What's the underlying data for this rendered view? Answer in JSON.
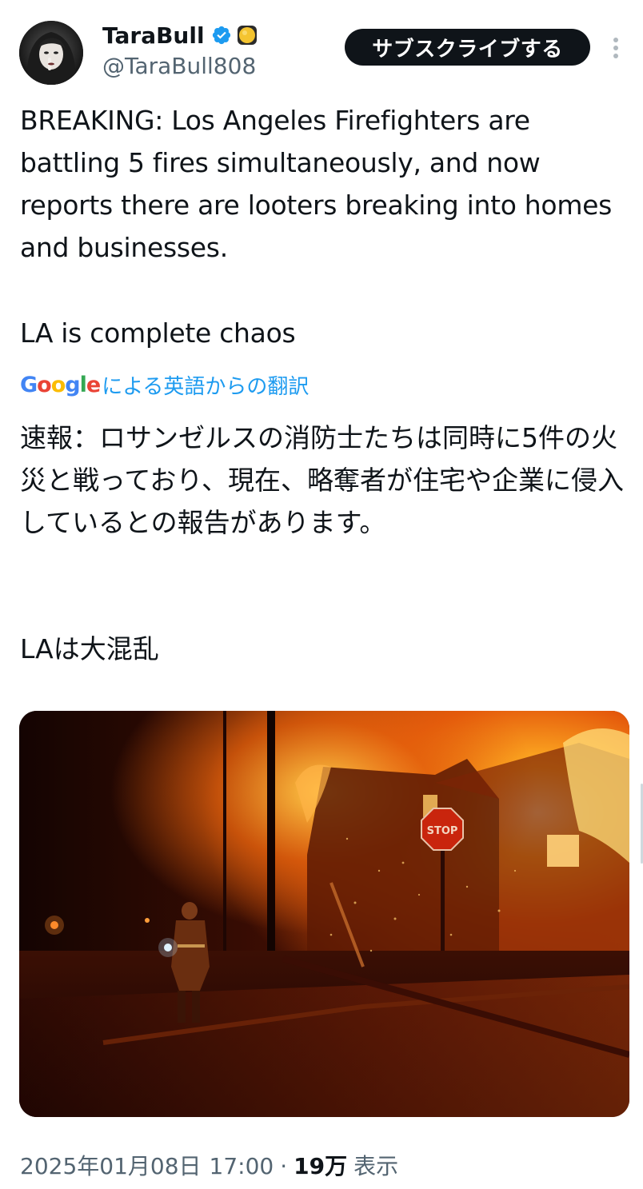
{
  "author": {
    "display_name": "TaraBull",
    "handle": "@TaraBull808",
    "verified_icon": "verified-badge-icon",
    "extra_icon": "yellow-circle-emoji-icon"
  },
  "actions": {
    "subscribe_label": "サブスクライブする",
    "more_icon": "more-vertical-icon"
  },
  "tweet": {
    "text_en_main": "BREAKING: Los Angeles Firefighters are battling 5 fires simultaneously, and now reports there are looters breaking into homes and businesses.",
    "text_en_tail": "LA is complete chaos",
    "translation_label": "による英語からの翻訳",
    "translation_provider": "Google",
    "text_ja_main": "速報：ロサンゼルスの消防士たちは同時に5件の火災と戦っており、現在、略奪者が住宅や企業に侵入しているとの報告があります。",
    "text_ja_tail": "LAは大混乱"
  },
  "meta": {
    "date": "2025年01月08日",
    "time": "17:00",
    "separator": "·",
    "views_count": "19万",
    "views_label": "表示"
  },
  "colors": {
    "text": "#0f1419",
    "muted": "#536471",
    "link": "#1d9bf0",
    "verified": "#1d9bf0",
    "button_bg": "#0f1419"
  }
}
